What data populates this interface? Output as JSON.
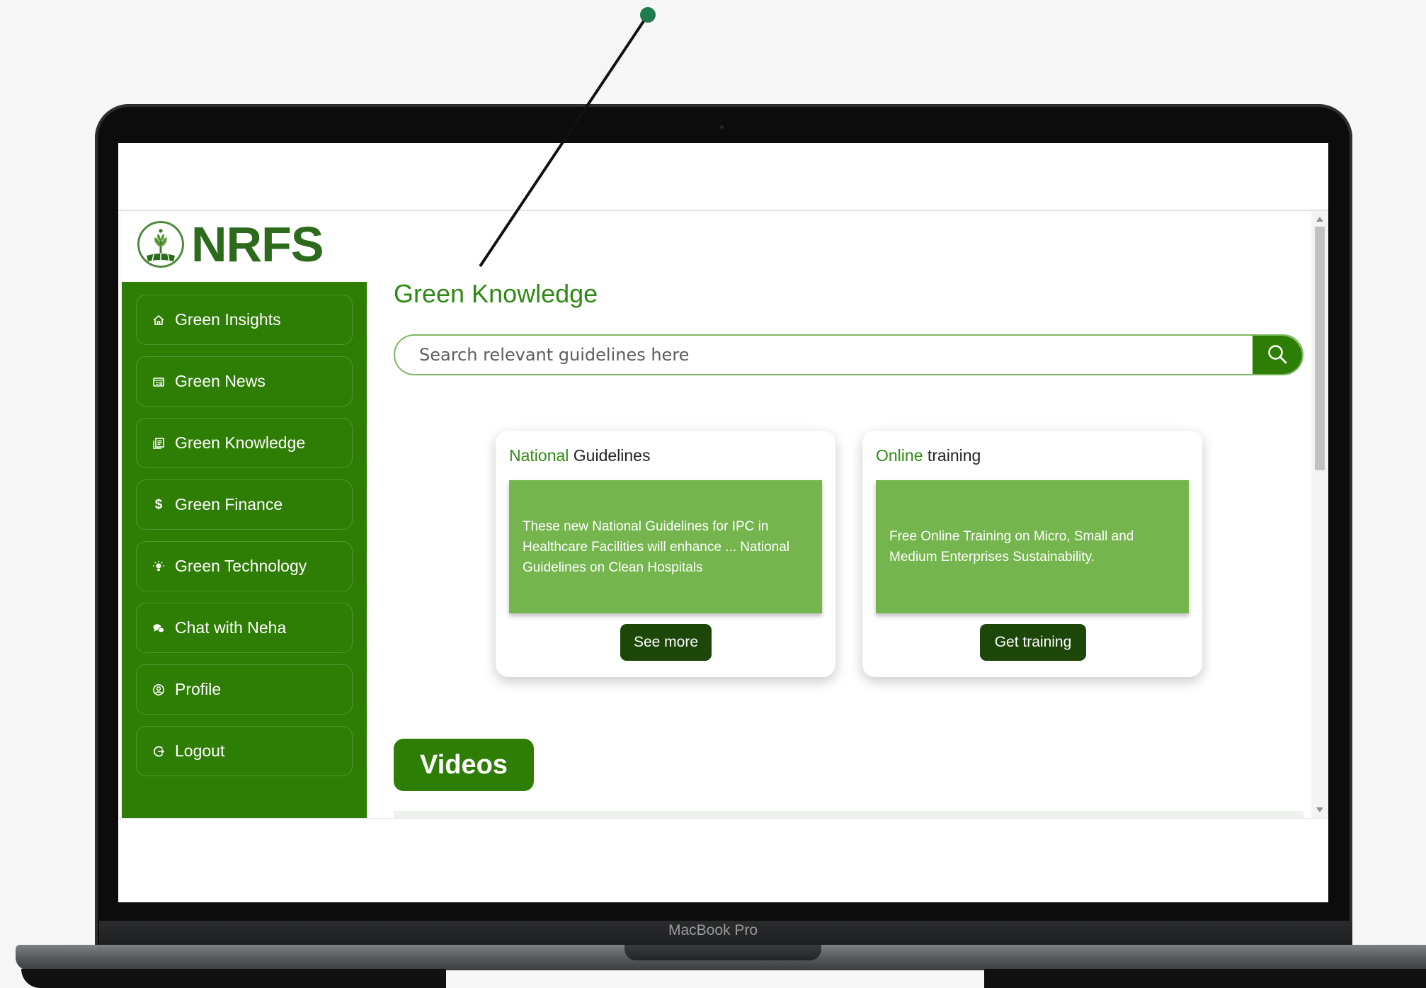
{
  "device": {
    "label": "MacBook Pro"
  },
  "brand": {
    "logo_text": "NRFS"
  },
  "sidebar": {
    "items": [
      {
        "label": "Green Insights",
        "icon": "home-icon"
      },
      {
        "label": "Green News",
        "icon": "newspaper-icon"
      },
      {
        "label": "Green Knowledge",
        "icon": "book-icon"
      },
      {
        "label": "Green Finance",
        "icon": "dollar-icon"
      },
      {
        "label": "Green Technology",
        "icon": "bulb-icon"
      },
      {
        "label": "Chat with Neha",
        "icon": "chat-icon"
      },
      {
        "label": "Profile",
        "icon": "user-circle-icon"
      },
      {
        "label": "Logout",
        "icon": "logout-icon"
      }
    ]
  },
  "main": {
    "title": "Green Knowledge",
    "search": {
      "placeholder": "Search relevant guidelines here",
      "value": ""
    },
    "cards": [
      {
        "title_highlight": "National",
        "title_rest": " Guidelines",
        "body": "These new National Guidelines for IPC in Healthcare Facilities will enhance ... National Guidelines on Clean Hospitals",
        "button": "See more"
      },
      {
        "title_highlight": "Online",
        "title_rest": " training",
        "body": "Free Online Training on Micro, Small and Medium Enterprises Sustainability.",
        "button": "Get training"
      }
    ],
    "videos_label": "Videos"
  },
  "colors": {
    "primary_green": "#2e7d05",
    "title_green": "#2e8a12",
    "card_green": "#74b54e",
    "dark_button": "#1c4709",
    "pointer_dot": "#1f7a4d"
  }
}
